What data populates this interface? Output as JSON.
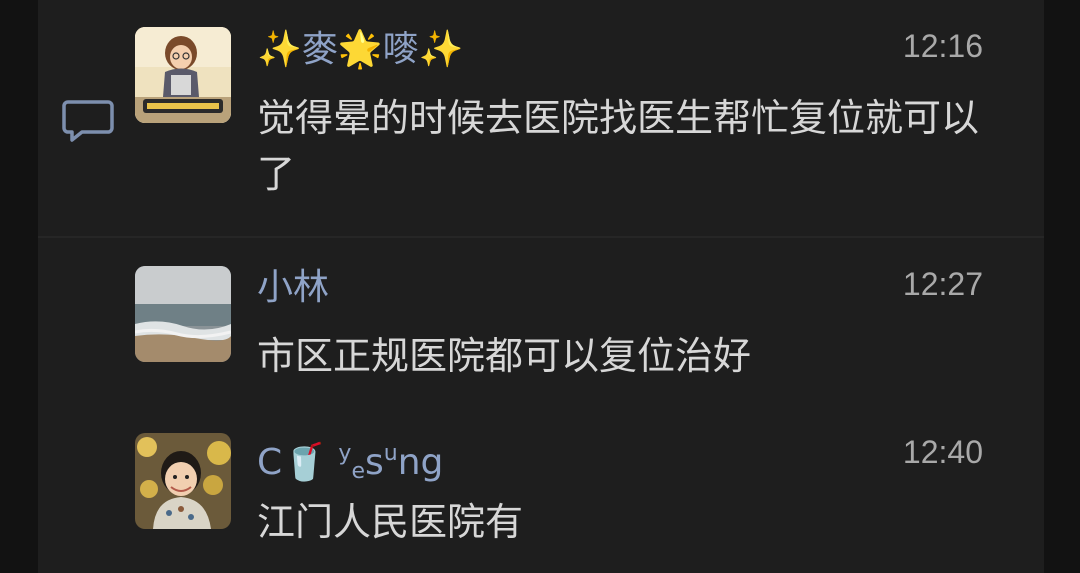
{
  "comments": [
    {
      "name": "✨麥🌟嘜✨",
      "time": "12:16",
      "text": "觉得晕的时候去医院找医生帮忙复位就可以了",
      "avatar": "cartoon-girl-avatar"
    },
    {
      "name": "小林",
      "time": "12:27",
      "text": "市区正规医院都可以复位治好",
      "avatar": "ocean-beach-avatar"
    },
    {
      "name_parts": [
        "C",
        "🥤",
        "y",
        "e",
        "s",
        "u",
        "ng"
      ],
      "time": "12:40",
      "text": "江门人民医院有",
      "avatar": "child-photo-avatar"
    }
  ],
  "icons": {
    "comment": "comment-bubble-icon"
  },
  "colors": {
    "background": "#1e1e1e",
    "name": "#8fa3c7",
    "text": "#d7d7d7",
    "time": "#a9a9a9"
  }
}
